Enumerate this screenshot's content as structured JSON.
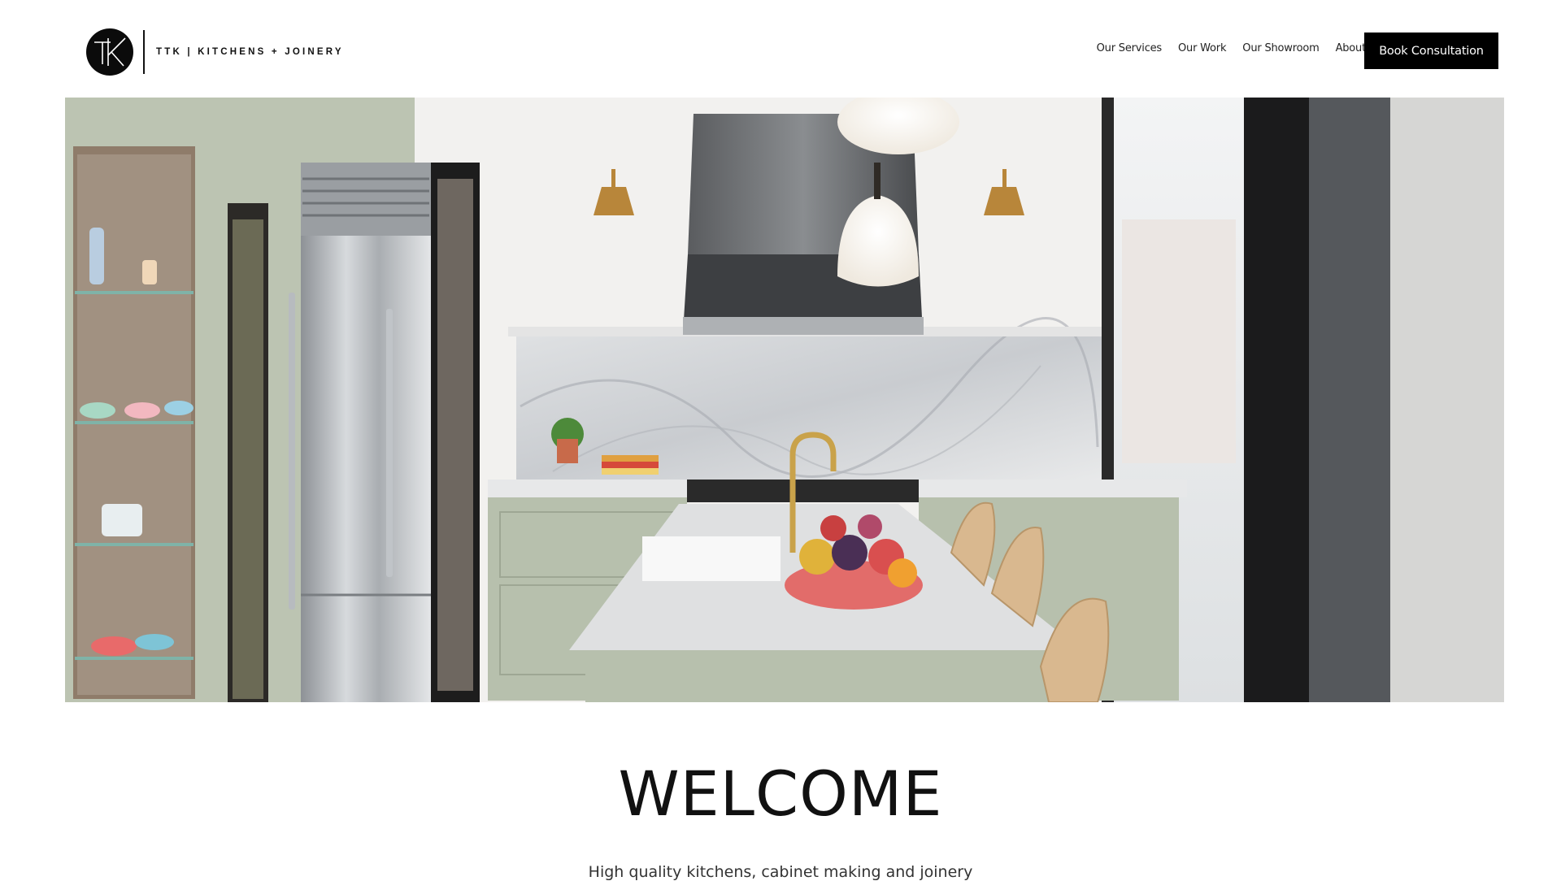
{
  "header": {
    "logo_text": "TTK | KITCHENS + JOINERY",
    "nav": [
      {
        "label": "Our Services"
      },
      {
        "label": "Our Work"
      },
      {
        "label": "Our Showroom"
      },
      {
        "label": "About"
      }
    ],
    "cta_label": "Book Consultation"
  },
  "hero": {
    "icon": "kitchen-photo"
  },
  "welcome": {
    "title": "WELCOME",
    "subtitle": "High quality kitchens, cabinet making and joinery"
  },
  "colors": {
    "accent": "#000000",
    "background": "#ffffff"
  }
}
